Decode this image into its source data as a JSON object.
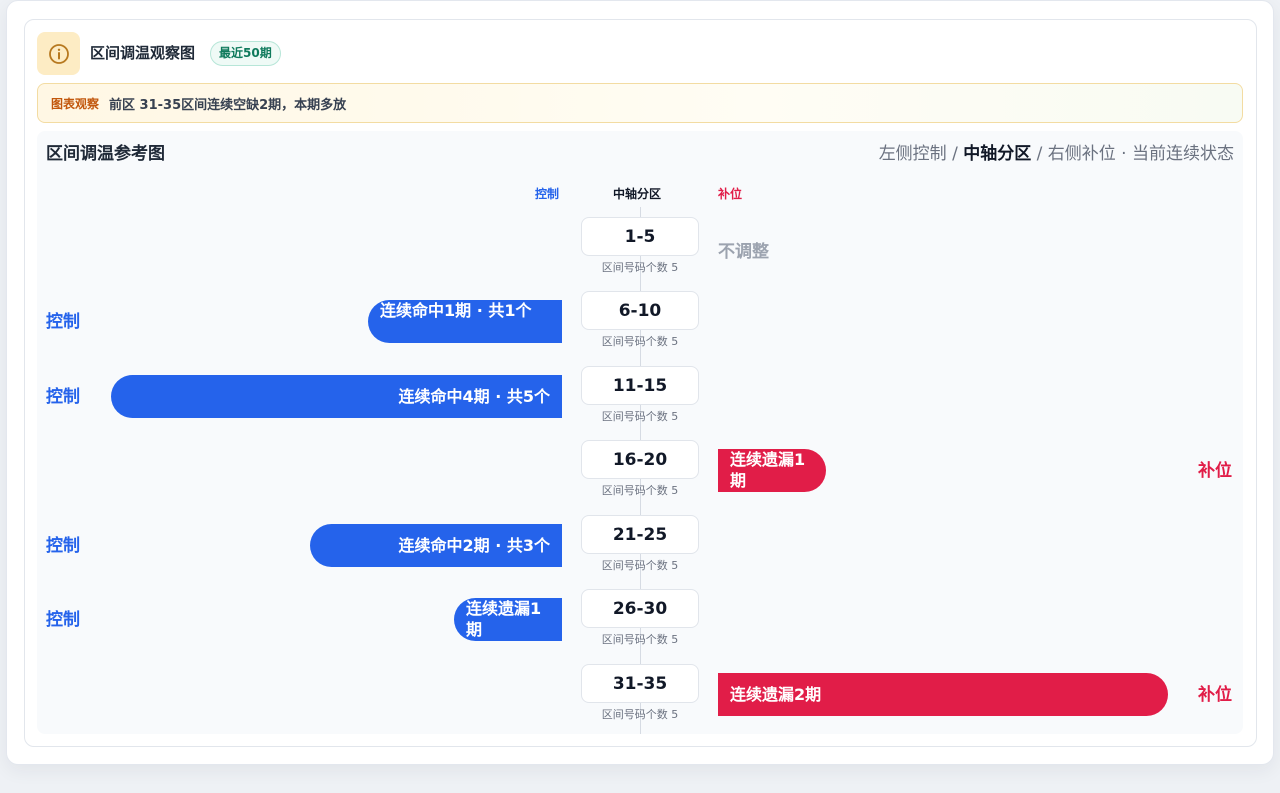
{
  "header": {
    "title": "区间调温观察图",
    "badge": "最近50期",
    "icon": "info-icon"
  },
  "notice": {
    "tag": "图表观察",
    "text": "前区 31-35区间连续空缺2期，本期多放"
  },
  "panel": {
    "title": "区间调温参考图",
    "legend": {
      "left": "左侧控制",
      "sep1": " / ",
      "center": "中轴分区",
      "sep2": " / ",
      "right": "右侧补位",
      "dot": " · ",
      "state": "当前连续状态"
    },
    "columns": {
      "left": "控制",
      "center": "中轴分区",
      "right": "补位"
    }
  },
  "colors": {
    "control": "#2563eb",
    "fill": "#e11d48",
    "neutral": "#9ca3af"
  },
  "rows": [
    {
      "range": "1-5",
      "count": "区间号码个数 5",
      "side": "none",
      "status": "不调整"
    },
    {
      "range": "6-10",
      "count": "区间号码个数 5",
      "side": "left",
      "label": "控制",
      "status": "连续命中1期 · 共1个"
    },
    {
      "range": "11-15",
      "count": "区间号码个数 5",
      "side": "left",
      "label": "控制",
      "status": "连续命中4期 · 共5个"
    },
    {
      "range": "16-20",
      "count": "区间号码个数 5",
      "side": "right",
      "label": "补位",
      "status": "连续遗漏1期"
    },
    {
      "range": "21-25",
      "count": "区间号码个数 5",
      "side": "left",
      "label": "控制",
      "status": "连续命中2期 · 共3个"
    },
    {
      "range": "26-30",
      "count": "区间号码个数 5",
      "side": "left",
      "label": "控制",
      "status": "连续遗漏1期"
    },
    {
      "range": "31-35",
      "count": "区间号码个数 5",
      "side": "right",
      "label": "补位",
      "status": "连续遗漏2期"
    }
  ]
}
